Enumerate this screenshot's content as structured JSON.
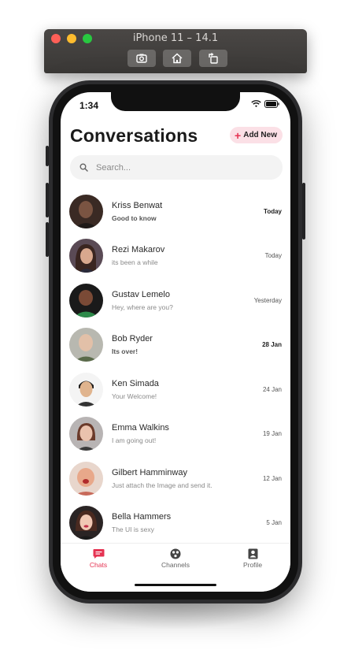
{
  "simulator": {
    "title": "iPhone 11 – 14.1"
  },
  "status": {
    "time": "1:34"
  },
  "header": {
    "title": "Conversations",
    "add_label": "Add New"
  },
  "search": {
    "placeholder": "Search..."
  },
  "conversations": [
    {
      "name": "Kriss Benwat",
      "message": "Good to know",
      "date": "Today",
      "unread": true
    },
    {
      "name": "Rezi Makarov",
      "message": "its been a while",
      "date": "Today",
      "unread": false
    },
    {
      "name": "Gustav Lemelo",
      "message": "Hey, where are you?",
      "date": "Yesterday",
      "unread": false
    },
    {
      "name": "Bob Ryder",
      "message": "Its over!",
      "date": "28 Jan",
      "unread": true
    },
    {
      "name": "Ken Simada",
      "message": "Your Welcome!",
      "date": "24 Jan",
      "unread": false
    },
    {
      "name": "Emma Walkins",
      "message": "I am going out!",
      "date": "19 Jan",
      "unread": false
    },
    {
      "name": "Gilbert Hamminway",
      "message": "Just attach the Image and send it.",
      "date": "12 Jan",
      "unread": false
    },
    {
      "name": "Bella Hammers",
      "message": "The UI is sexy",
      "date": "5 Jan",
      "unread": false
    }
  ],
  "tabs": [
    {
      "label": "Chats",
      "icon": "chat-icon",
      "active": true
    },
    {
      "label": "Channels",
      "icon": "channels-icon",
      "active": false
    },
    {
      "label": "Profile",
      "icon": "profile-icon",
      "active": false
    }
  ],
  "colors": {
    "accent": "#e53352",
    "accent_soft": "#fbe0e6"
  }
}
